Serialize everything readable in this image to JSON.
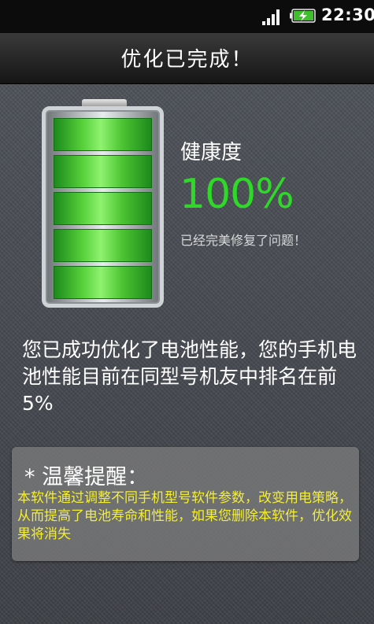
{
  "status_bar": {
    "time": "22:30",
    "icons": [
      "signal-icon",
      "battery-charging-icon"
    ]
  },
  "title_bar": {
    "title": "优化已完成！"
  },
  "battery": {
    "level_percent": 100,
    "cells": 5,
    "fill_color": "#4cc432"
  },
  "health": {
    "label": "健康度",
    "value": "100%",
    "note": "已经完美修复了问题！"
  },
  "result": {
    "text": "您已成功优化了电池性能，您的手机电池性能目前在同型号机友中排名在前5%"
  },
  "tip": {
    "title": "* 温馨提醒：",
    "text": "本软件通过调整不同手机型号软件参数，改变用电策略，从而提高了电池寿命和性能，如果您删除本软件，优化效果将消失"
  },
  "colors": {
    "health_value": "#2fd829",
    "tip_text": "#f3ee34",
    "status_bar": "#0c0c0c"
  }
}
